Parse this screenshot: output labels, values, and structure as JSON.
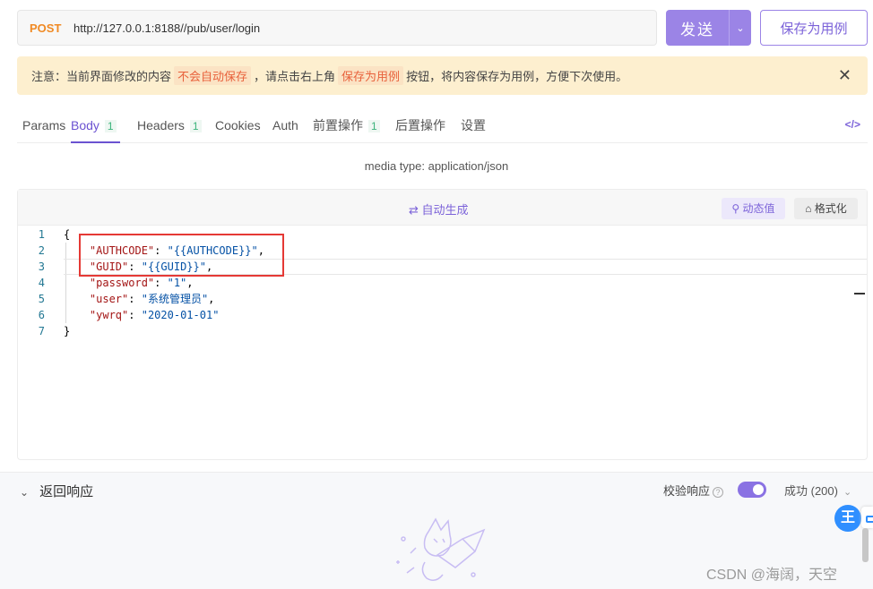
{
  "request": {
    "method": "POST",
    "url": "http://127.0.0.1:8188//pub/user/login",
    "send_label": "发送",
    "save_label": "保存为用例"
  },
  "notice": {
    "prefix": "注意：当前界面修改的内容",
    "highlight1": "不会自动保存",
    "middle": "，请点击右上角",
    "highlight2": "保存为用例",
    "suffix": "按钮，将内容保存为用例，方便下次使用。",
    "close": "✕"
  },
  "tabs": [
    {
      "label": "Params",
      "count": ""
    },
    {
      "label": "Body",
      "count": "1"
    },
    {
      "label": "Headers",
      "count": "1"
    },
    {
      "label": "Cookies",
      "count": ""
    },
    {
      "label": "Auth",
      "count": ""
    },
    {
      "label": "前置操作",
      "count": "1"
    },
    {
      "label": "后置操作",
      "count": ""
    },
    {
      "label": "设置",
      "count": ""
    }
  ],
  "code_toggle": "</>",
  "media_type": "media type: application/json",
  "editor": {
    "auto_generate": "⇄ 自动生成",
    "dynamic_value": "动态值",
    "format": "格式化",
    "lines": [
      {
        "num": "1",
        "text": "{"
      },
      {
        "num": "2",
        "key": "\"AUTHCODE\"",
        "value": "\"{{AUTHCODE}}\"",
        "trail": ","
      },
      {
        "num": "3",
        "key": "\"GUID\"",
        "value": "\"{{GUID}}\"",
        "trail": ","
      },
      {
        "num": "4",
        "key": "\"password\"",
        "value": "\"1\"",
        "trail": ","
      },
      {
        "num": "5",
        "key": "\"user\"",
        "value": "\"系统管理员\"",
        "trail": ","
      },
      {
        "num": "6",
        "key": "\"ywrq\"",
        "value": "\"2020-01-01\"",
        "trail": ""
      },
      {
        "num": "7",
        "text": "}"
      }
    ]
  },
  "response": {
    "title": "返回响应",
    "validate_label": "校验响应",
    "status": "成功 (200)"
  },
  "watermark": "CSDN @海阔，天空",
  "colors": {
    "accent": "#9b84e6",
    "method": "#f08a24",
    "highlight": "#e8613b",
    "notice_bg": "#fdefcf",
    "json_key": "#a31515",
    "json_string": "#0451a5"
  }
}
